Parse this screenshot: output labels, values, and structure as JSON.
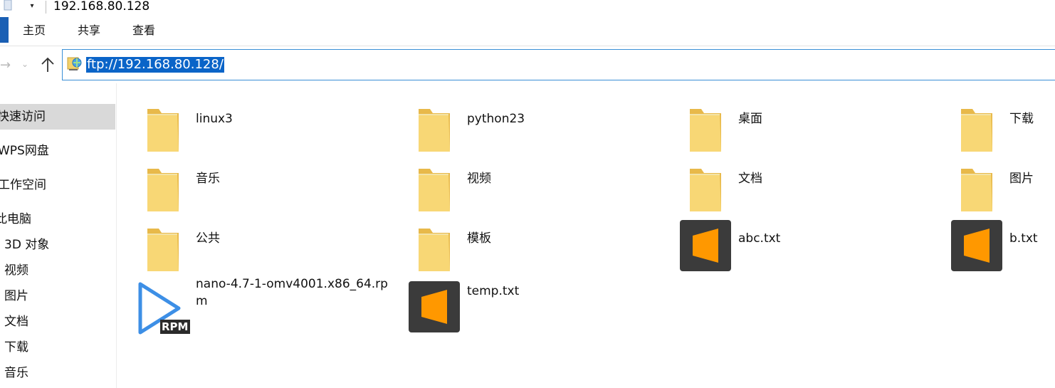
{
  "window": {
    "title": "192.168.80.128",
    "quick_access_dropdown": "▾"
  },
  "ribbon": {
    "tabs": [
      "主页",
      "共享",
      "查看"
    ]
  },
  "address_bar": {
    "path": "ftp://192.168.80.128/"
  },
  "sidebar": {
    "items": [
      {
        "label": "快速访问",
        "selected": true
      },
      {
        "label": "WPS网盘"
      },
      {
        "label": "工作空间"
      },
      {
        "label": "此电脑"
      },
      {
        "label": "3D 对象"
      },
      {
        "label": "视频"
      },
      {
        "label": "图片"
      },
      {
        "label": "文档"
      },
      {
        "label": "下载"
      },
      {
        "label": "音乐"
      }
    ]
  },
  "files": [
    {
      "name": "linux3",
      "type": "folder"
    },
    {
      "name": "python23",
      "type": "folder"
    },
    {
      "name": "桌面",
      "type": "folder"
    },
    {
      "name": "下载",
      "type": "folder"
    },
    {
      "name": "音乐",
      "type": "folder"
    },
    {
      "name": "视频",
      "type": "folder"
    },
    {
      "name": "文档",
      "type": "folder"
    },
    {
      "name": "图片",
      "type": "folder"
    },
    {
      "name": "公共",
      "type": "folder"
    },
    {
      "name": "模板",
      "type": "folder"
    },
    {
      "name": "abc.txt",
      "type": "sublime-text-file"
    },
    {
      "name": "b.txt",
      "type": "sublime-text-file"
    },
    {
      "name": "nano-4.7-1-omv4001.x86_64.rpm",
      "type": "rpm-package"
    },
    {
      "name": "temp.txt",
      "type": "sublime-text-file"
    }
  ],
  "icons": {
    "rpm_badge": "RPM"
  },
  "colors": {
    "accent": "#0a64c8",
    "folder": "#f8d775",
    "sublime_bg": "#3b3b3b",
    "sublime_logo": "#ff9800",
    "rpm_play": "#3d8fe6",
    "sidebar_selected": "#d9d9d9"
  }
}
